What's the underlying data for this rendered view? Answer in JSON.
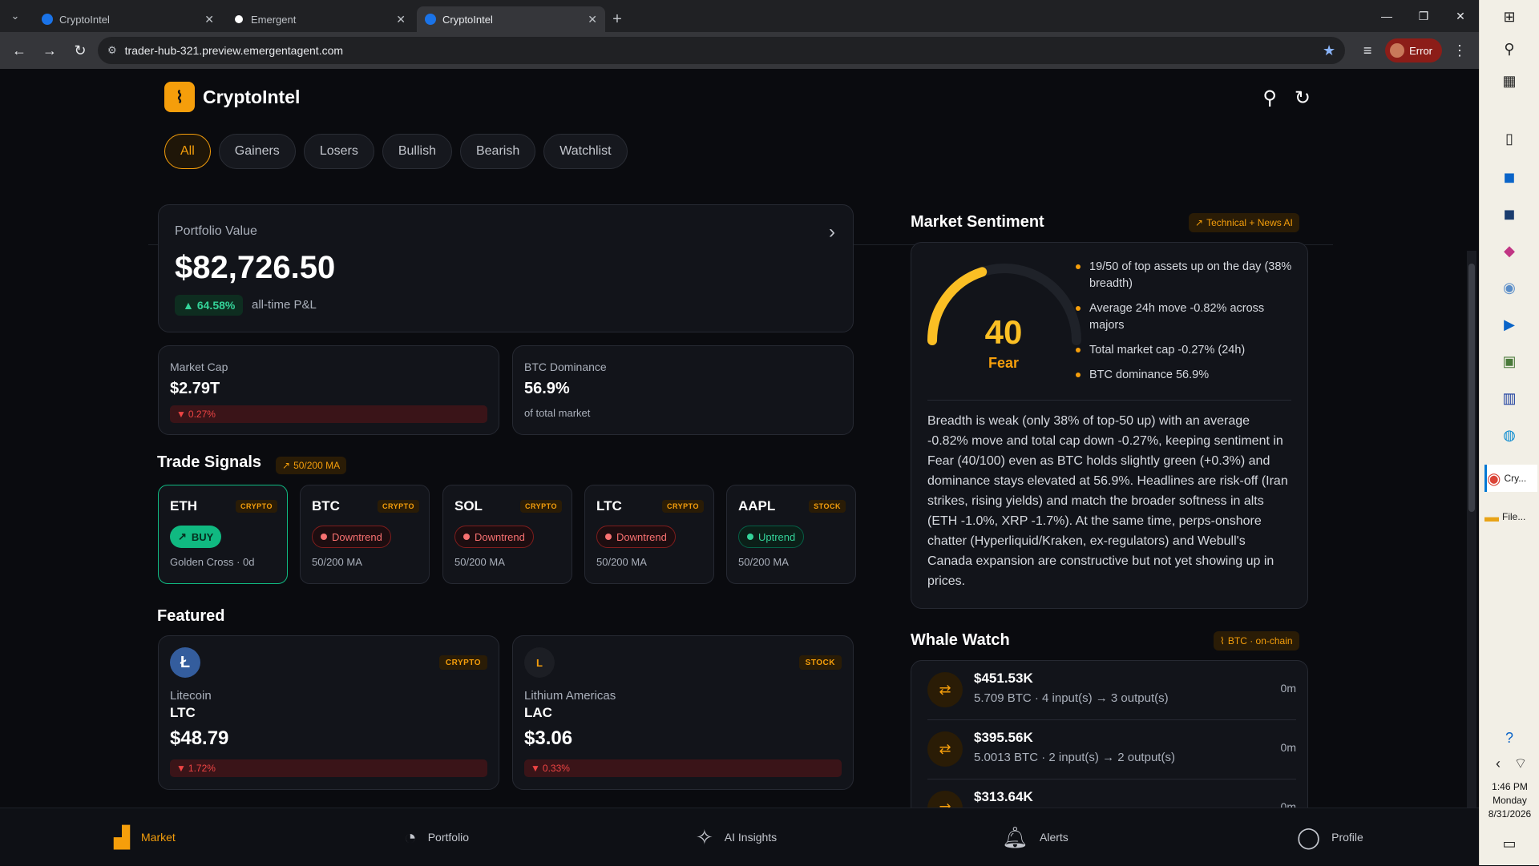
{
  "browser": {
    "tabs": [
      {
        "title": "CryptoIntel",
        "active": false
      },
      {
        "title": "Emergent",
        "active": false
      },
      {
        "title": "CryptoIntel",
        "active": true
      }
    ],
    "url": "trader-hub-321.preview.emergentagent.com",
    "profile_status": "Error"
  },
  "taskbar": {
    "apps": [
      {
        "label": "Cry..."
      },
      {
        "label": "File..."
      }
    ],
    "time": "1:46 PM",
    "day": "Monday",
    "date": "8/31/2026"
  },
  "app": {
    "name": "CryptoIntel",
    "filters": [
      "All",
      "Gainers",
      "Losers",
      "Bullish",
      "Bearish",
      "Watchlist"
    ],
    "active_filter": "All"
  },
  "portfolio": {
    "label": "Portfolio Value",
    "value": "$82,726.50",
    "change": "64.58%",
    "change_label": "all-time P&L"
  },
  "stats": {
    "market_cap": {
      "label": "Market Cap",
      "value": "$2.79T",
      "change": "0.27%"
    },
    "btc_dominance": {
      "label": "BTC Dominance",
      "value": "56.9%",
      "sub": "of total market"
    }
  },
  "trade_signals": {
    "title": "Trade Signals",
    "tag": "50/200 MA",
    "items": [
      {
        "symbol": "ETH",
        "kind": "CRYPTO",
        "status": "BUY",
        "note": "Golden Cross · 0d"
      },
      {
        "symbol": "BTC",
        "kind": "CRYPTO",
        "status": "Downtrend",
        "note": "50/200 MA"
      },
      {
        "symbol": "SOL",
        "kind": "CRYPTO",
        "status": "Downtrend",
        "note": "50/200 MA"
      },
      {
        "symbol": "LTC",
        "kind": "CRYPTO",
        "status": "Downtrend",
        "note": "50/200 MA"
      },
      {
        "symbol": "AAPL",
        "kind": "STOCK",
        "status": "Uptrend",
        "note": "50/200 MA"
      }
    ]
  },
  "featured": {
    "title": "Featured",
    "items": [
      {
        "icon": "Ł",
        "kind": "CRYPTO",
        "name": "Litecoin",
        "symbol": "LTC",
        "price": "$48.79",
        "change": "1.72%"
      },
      {
        "icon": "L",
        "kind": "STOCK",
        "name": "Lithium Americas",
        "symbol": "LAC",
        "price": "$3.06",
        "change": "0.33%"
      }
    ]
  },
  "sentiment": {
    "title": "Market Sentiment",
    "tag": "Technical + News AI",
    "score": "40",
    "score_value": 40,
    "score_max": 100,
    "label": "Fear",
    "bullets": [
      "19/50 of top assets up on the day (38% breadth)",
      "Average 24h move -0.82% across majors",
      "Total market cap -0.27% (24h)",
      "BTC dominance 56.9%"
    ],
    "summary": "Breadth is weak (only 38% of top-50 up) with an average -0.82% move and total cap down -0.27%, keeping sentiment in Fear (40/100) even as BTC holds slightly green (+0.3%) and dominance stays elevated at 56.9%. Headlines are risk-off (Iran strikes, rising yields) and match the broader softness in alts (ETH -1.0%, XRP -1.7%). At the same time, perps-onshore chatter (Hyperliquid/Kraken, ex-regulators) and Webull's Canada expansion are constructive but not yet showing up in prices."
  },
  "whale_watch": {
    "title": "Whale Watch",
    "tag": "BTC · on-chain",
    "items": [
      {
        "amount": "$451.53K",
        "detail": "5.709 BTC · 4 input(s) → 3 output(s)",
        "time": "0m"
      },
      {
        "amount": "$395.56K",
        "detail": "5.0013 BTC · 2 input(s) → 2 output(s)",
        "time": "0m"
      },
      {
        "amount": "$313.64K",
        "detail": "",
        "time": "0m"
      }
    ]
  },
  "nav": [
    "Market",
    "Portfolio",
    "AI Insights",
    "Alerts",
    "Profile"
  ],
  "colors": {
    "accent": "#f59e0b",
    "up": "#10b981",
    "down": "#ef4444",
    "bg": "#0a0b0f"
  }
}
